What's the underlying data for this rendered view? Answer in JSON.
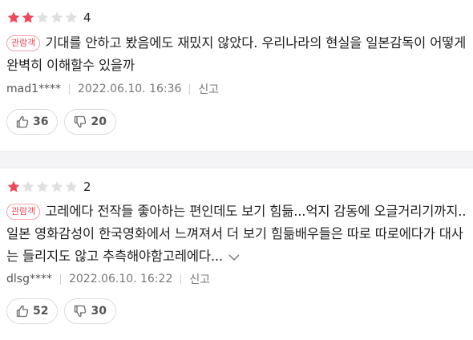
{
  "reviews": [
    {
      "rating": 2,
      "max_rating": 5,
      "rating_label": "4",
      "badge": "관람객",
      "text": "기대를 안하고 봤음에도 재밌지 않았다. 우리나라의 현실을 일본감독이 어떻게 완벽히 이해할수 있을까",
      "author": "mad1****",
      "date": "2022.06.10. 16:36",
      "report": "신고",
      "likes": "36",
      "dislikes": "20"
    },
    {
      "rating": 1,
      "max_rating": 5,
      "rating_label": "2",
      "badge": "관람객",
      "text": "고레에다 전작들 좋아하는 편인데도 보기 힘듦...억지 감동에 오글거리기까지..일본 영화감성이 한국영화에서 느껴져서 더 보기 힘듦배우들은 따로 따로에다가 대사는 들리지도 않고 추측해야함고레에다...",
      "author": "dlsg****",
      "date": "2022.06.10. 16:22",
      "report": "신고",
      "likes": "52",
      "dislikes": "30"
    }
  ],
  "colors": {
    "star_filled": "#f0485a",
    "star_empty": "#e0e0e0",
    "badge": "#e8495a"
  },
  "icons": {
    "like": "thumbs-up-icon",
    "dislike": "thumbs-down-icon",
    "expand": "chevron-down-icon"
  }
}
